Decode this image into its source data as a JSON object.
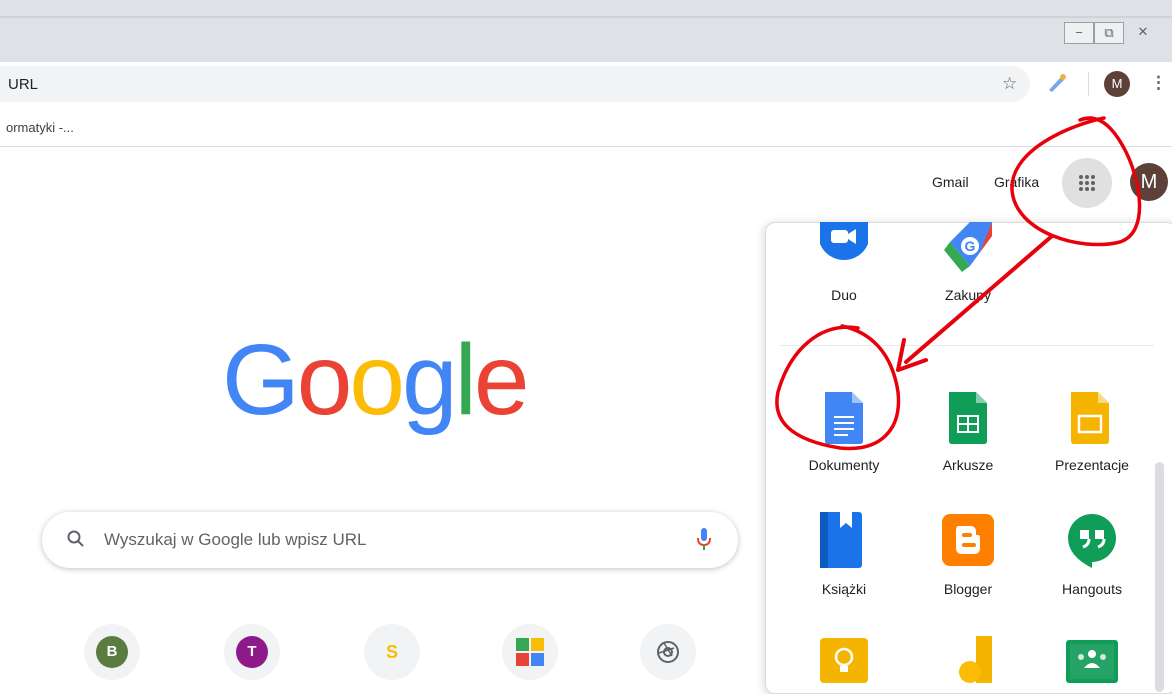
{
  "window": {
    "minimize_glyph": "−",
    "restore_glyph": "⧉",
    "close_glyph": "✕"
  },
  "toolbar": {
    "url": "URL",
    "star_icon": "star-icon",
    "avatar_letter": "M",
    "menu_glyph": "⋮"
  },
  "bookmarks": {
    "item": "ormatyki -..."
  },
  "header": {
    "gmail": "Gmail",
    "grafika": "Grafika",
    "avatar_letter": "M"
  },
  "logo": {
    "letters": [
      "G",
      "o",
      "o",
      "g",
      "l",
      "e"
    ],
    "colors": [
      "#4285f4",
      "#ea4335",
      "#fbbc05",
      "#4285f4",
      "#34a853",
      "#ea4335"
    ]
  },
  "search": {
    "placeholder": "Wyszukaj w Google lub wpisz URL"
  },
  "shortcuts": [
    {
      "letter": "B",
      "color": "#5b7c3f"
    },
    {
      "letter": "T",
      "color": "#8e1a8a"
    },
    {
      "letter": "S",
      "color": "#fbbc05"
    },
    {
      "letter": "",
      "color": "#4285f4"
    },
    {
      "letter": "",
      "color": "#9aa0a6"
    }
  ],
  "apps": {
    "top_row": [
      {
        "label": "Duo"
      },
      {
        "label": "Zakupy"
      }
    ],
    "row1": [
      {
        "label": "Dokumenty"
      },
      {
        "label": "Arkusze"
      },
      {
        "label": "Prezentacje"
      }
    ],
    "row2": [
      {
        "label": "Książki"
      },
      {
        "label": "Blogger"
      },
      {
        "label": "Hangouts"
      }
    ]
  },
  "colors": {
    "annotation_red": "#e8000b"
  }
}
